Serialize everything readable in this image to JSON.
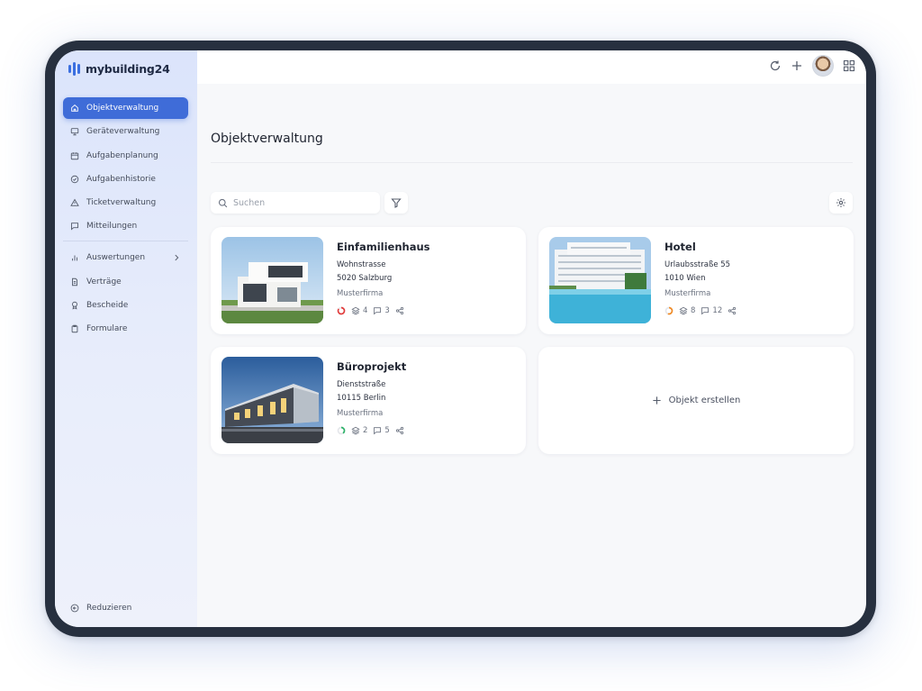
{
  "app": {
    "name": "mybuilding24"
  },
  "sidebar": {
    "items": [
      {
        "label": "Objektverwaltung",
        "icon": "home-icon",
        "active": true
      },
      {
        "label": "Geräteverwaltung",
        "icon": "monitor-icon"
      },
      {
        "label": "Aufgabenplanung",
        "icon": "calendar-icon"
      },
      {
        "label": "Aufgabenhistorie",
        "icon": "check-circle-icon"
      },
      {
        "label": "Ticketverwaltung",
        "icon": "warning-icon"
      },
      {
        "label": "Mitteilungen",
        "icon": "message-icon"
      }
    ],
    "items2": [
      {
        "label": "Auswertungen",
        "icon": "bar-chart-icon"
      },
      {
        "label": "Verträge",
        "icon": "document-icon"
      },
      {
        "label": "Bescheide",
        "icon": "award-icon"
      },
      {
        "label": "Formulare",
        "icon": "clipboard-icon"
      }
    ],
    "collapse_label": "Reduzieren"
  },
  "topbar": {
    "icons": [
      "refresh-icon",
      "plus-icon",
      "avatar",
      "grid-icon"
    ]
  },
  "main": {
    "title": "Objektverwaltung",
    "search_placeholder": "Suchen",
    "cards": [
      {
        "name": "Einfamilienhaus",
        "street": "Wohnstrasse",
        "city": "5020 Salzburg",
        "company": "Musterfirma",
        "progress_color": "#e23b3b",
        "progress": 0.85,
        "layers": "4",
        "messages": "3"
      },
      {
        "name": "Hotel",
        "street": "Urlaubsstraße 55",
        "city": "1010 Wien",
        "company": "Musterfirma",
        "progress_color": "#f08a24",
        "progress": 0.55,
        "layers": "8",
        "messages": "12"
      },
      {
        "name": "Büroprojekt",
        "street": "Dienststraße",
        "city": "10115 Berlin",
        "company": "Musterfirma",
        "progress_color": "#2fb36b",
        "progress": 0.4,
        "layers": "2",
        "messages": "5"
      }
    ],
    "create_label": "Objekt erstellen"
  }
}
